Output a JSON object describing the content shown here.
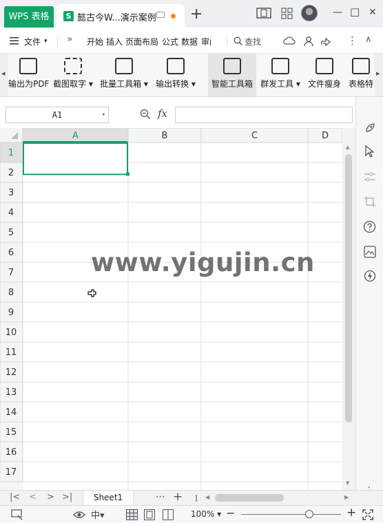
{
  "titlebar": {
    "app_tab": "WPS 表格",
    "doc_tab_icon": "S",
    "doc_tab_title": "懿古今W...演示案例",
    "new_tab": "+",
    "minimize": "—",
    "maximize": "□",
    "close": "✕"
  },
  "menubar": {
    "file": "文件",
    "more": "»",
    "tabs": [
      "开始",
      "插入",
      "页面布局",
      "公式",
      "数据",
      "审阅"
    ],
    "search": "查找",
    "overflow": "⋮",
    "collapse": "∧"
  },
  "ribbon": {
    "tools": [
      {
        "label": "输出为PDF"
      },
      {
        "label": "截图取字 ▾"
      },
      {
        "label": "批量工具箱 ▾"
      },
      {
        "label": "输出转换 ▾"
      },
      {
        "label": "智能工具箱"
      },
      {
        "label": "群发工具 ▾"
      },
      {
        "label": "文件瘦身"
      },
      {
        "label": "表格特"
      }
    ]
  },
  "formula": {
    "cell_ref": "A1",
    "fx": "fx"
  },
  "grid": {
    "columns": [
      "A",
      "B",
      "C",
      "D"
    ],
    "rows": [
      "1",
      "2",
      "3",
      "4",
      "5",
      "6",
      "7",
      "8",
      "9",
      "10",
      "11",
      "12",
      "13",
      "14",
      "15",
      "16",
      "17"
    ],
    "selected_column": "A",
    "selected_row": "1"
  },
  "watermark": "www.yigujin.cn",
  "sheetbar": {
    "sheet_name": "Sheet1",
    "more": "⋯",
    "add": "+"
  },
  "statusbar": {
    "zoom": "100% ▾",
    "zoom_out": "−",
    "zoom_in": "+",
    "zoom_level": 0.68
  },
  "colors": {
    "accent": "#12a468",
    "selection": "#1f9d6a",
    "header_selected": "#e0e0e0"
  }
}
